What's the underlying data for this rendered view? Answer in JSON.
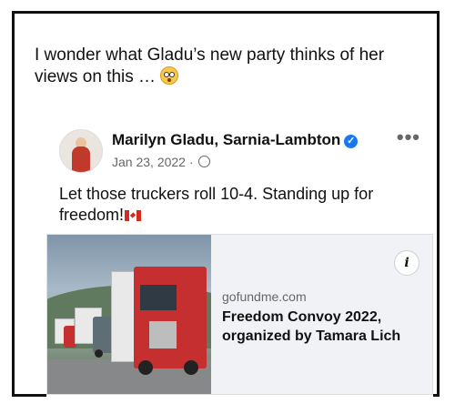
{
  "tweet": {
    "text": "I wonder what Gladu’s new party thinks of her views on this … ",
    "emoji_icon": "flushed-face-icon"
  },
  "post": {
    "author": "Marilyn Gladu, Sarnia-Lambton",
    "date": "Jan 23, 2022 · ",
    "text": "Let those truckers roll 10-4. Standing up for freedom!",
    "more_label": "•••",
    "verified_icon": "verified-badge-icon",
    "privacy_icon": "globe-icon",
    "flag_icon": "canada-flag-icon"
  },
  "link": {
    "domain": "gofundme.com",
    "title": "Freedom Convoy 2022, organized by Tamara Lich",
    "info_label": "i",
    "image_icon": "trucks-photo"
  },
  "colors": {
    "verified_blue": "#1877f2",
    "meta_gray": "#65676b",
    "card_bg": "#f0f2f5"
  }
}
